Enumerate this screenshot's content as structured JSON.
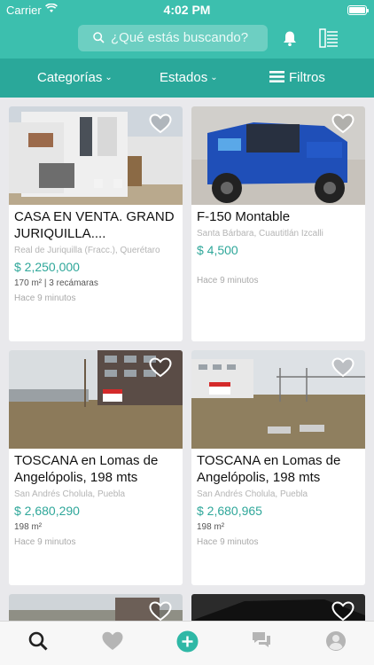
{
  "status": {
    "carrier": "Carrier",
    "time": "4:02 PM"
  },
  "header": {
    "search_placeholder": "¿Qué estás buscando?"
  },
  "filters": {
    "categories": "Categorías",
    "states": "Estados",
    "filters": "Filtros"
  },
  "colors": {
    "primary": "#3cbfae",
    "filterbar": "#2aa89a",
    "price": "#2fa79a",
    "heart": "#ffffff"
  },
  "listings": [
    {
      "title": "CASA EN VENTA. GRAND JURIQUILLA....",
      "location": "Real de Juriquilla (Fracc.), Querétaro",
      "price": "$ 2,250,000",
      "specs": "170 m²  |  3 recámaras",
      "time": "Hace 9 minutos"
    },
    {
      "title": "F-150 Montable",
      "location": "Santa Bárbara, Cuautitlán Izcalli",
      "price": "$ 4,500",
      "specs": "",
      "time": "Hace 9 minutos"
    },
    {
      "title": "TOSCANA en Lomas de Angelópolis, 198 mts",
      "location": "San Andrés Cholula, Puebla",
      "price": "$ 2,680,290",
      "specs": "198 m²",
      "time": "Hace 9 minutos"
    },
    {
      "title": "TOSCANA en Lomas de Angelópolis, 198 mts",
      "location": "San Andrés Cholula, Puebla",
      "price": "$ 2,680,965",
      "specs": "198 m²",
      "time": "Hace 9 minutos"
    }
  ],
  "tabbar": {
    "items": [
      "search-icon",
      "heart-icon",
      "plus-icon",
      "chat-icon",
      "profile-icon"
    ]
  }
}
